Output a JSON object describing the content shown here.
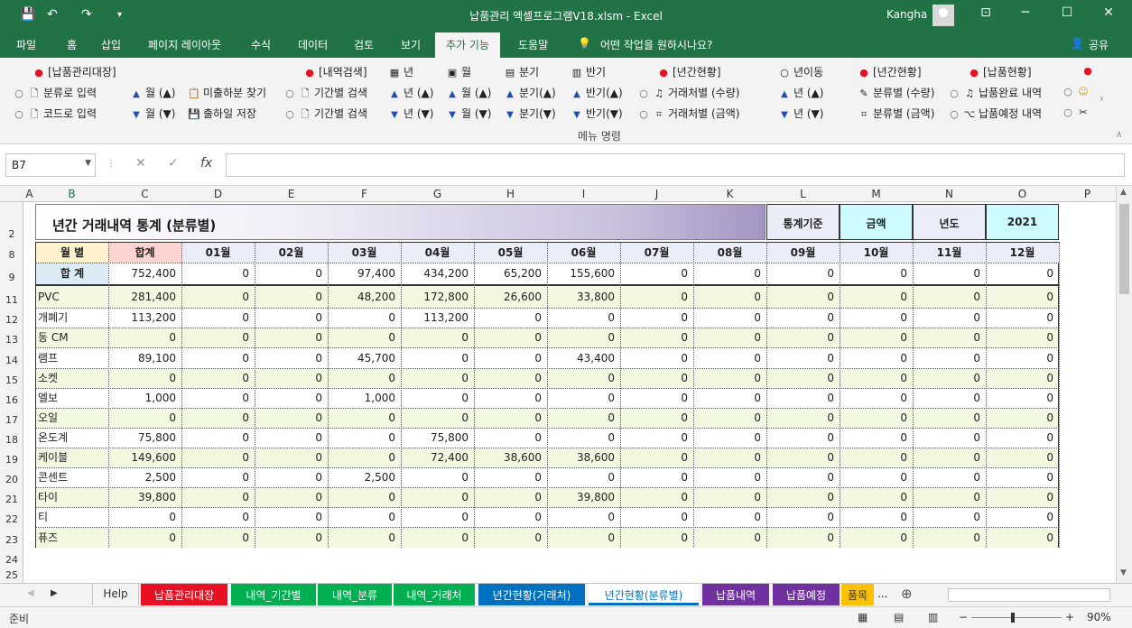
{
  "window": {
    "title": "납품관리 엑셀프로그램V18.xlsm  -  Excel",
    "user": "Kangha"
  },
  "tabs": [
    "파일",
    "홈",
    "삽입",
    "페이지 레이아웃",
    "수식",
    "데이터",
    "검토",
    "보기",
    "추가 기능",
    "도움말",
    "어떤 작업을 원하시나요?",
    "공유"
  ],
  "ribbon": {
    "r1": [
      "[납품관리대장]",
      "[내역검색]",
      "년",
      "월",
      "분기",
      "반기",
      "[년간현황]",
      "년이동",
      "[년간현황]",
      "[납품현황]"
    ],
    "r2": [
      "분류로 입력",
      "월 (▲)",
      "미출하분 찾기",
      "기간별 검색",
      "년 (▲)",
      "월 (▲)",
      "분기(▲)",
      "반기(▲)",
      "거래처별 (수량)",
      "년 (▲)",
      "분류별 (수량)",
      "납품완료 내역"
    ],
    "r3": [
      "코드로 입력",
      "월 (▼)",
      "출하일 저장",
      "기간별 검색",
      "년 (▼)",
      "월 (▼)",
      "분기(▼)",
      "반기(▼)",
      "거래처별 (금액)",
      "년 (▼)",
      "분류별 (금액)",
      "납품예정 내역"
    ],
    "footer": "메뉴 명령"
  },
  "namebox": "B7",
  "columns": [
    "A",
    "B",
    "C",
    "D",
    "E",
    "F",
    "G",
    "H",
    "I",
    "J",
    "K",
    "L",
    "M",
    "N",
    "O",
    "P"
  ],
  "rows": [
    "2",
    "8",
    "9",
    "11",
    "12",
    "13",
    "14",
    "15",
    "16",
    "17",
    "18",
    "19",
    "20",
    "21",
    "22",
    "23",
    "24",
    "25"
  ],
  "report": {
    "title": "년간 거래내역 통계 (분류별)",
    "basis_label": "통계기준",
    "basis_value": "금액",
    "year_label": "년도",
    "year_value": "2021",
    "month_header": "월  별",
    "total_header": "합계",
    "months": [
      "01월",
      "02월",
      "03월",
      "04월",
      "05월",
      "06월",
      "07월",
      "08월",
      "09월",
      "10월",
      "11월",
      "12월"
    ],
    "sum_label": "합  계",
    "sum_values": [
      "752,400",
      "0",
      "0",
      "97,400",
      "434,200",
      "65,200",
      "155,600",
      "0",
      "0",
      "0",
      "0",
      "0",
      "0"
    ],
    "items": [
      {
        "name": "PVC",
        "values": [
          "281,400",
          "0",
          "0",
          "48,200",
          "172,800",
          "26,600",
          "33,800",
          "0",
          "0",
          "0",
          "0",
          "0",
          "0"
        ]
      },
      {
        "name": "개폐기",
        "values": [
          "113,200",
          "0",
          "0",
          "0",
          "113,200",
          "0",
          "0",
          "0",
          "0",
          "0",
          "0",
          "0",
          "0"
        ]
      },
      {
        "name": "동 CM",
        "values": [
          "0",
          "0",
          "0",
          "0",
          "0",
          "0",
          "0",
          "0",
          "0",
          "0",
          "0",
          "0",
          "0"
        ]
      },
      {
        "name": "램프",
        "values": [
          "89,100",
          "0",
          "0",
          "45,700",
          "0",
          "0",
          "43,400",
          "0",
          "0",
          "0",
          "0",
          "0",
          "0"
        ]
      },
      {
        "name": "소켓",
        "values": [
          "0",
          "0",
          "0",
          "0",
          "0",
          "0",
          "0",
          "0",
          "0",
          "0",
          "0",
          "0",
          "0"
        ]
      },
      {
        "name": "엘보",
        "values": [
          "1,000",
          "0",
          "0",
          "1,000",
          "0",
          "0",
          "0",
          "0",
          "0",
          "0",
          "0",
          "0",
          "0"
        ]
      },
      {
        "name": "오일",
        "values": [
          "0",
          "0",
          "0",
          "0",
          "0",
          "0",
          "0",
          "0",
          "0",
          "0",
          "0",
          "0",
          "0"
        ]
      },
      {
        "name": "온도계",
        "values": [
          "75,800",
          "0",
          "0",
          "0",
          "75,800",
          "0",
          "0",
          "0",
          "0",
          "0",
          "0",
          "0",
          "0"
        ]
      },
      {
        "name": "케이블",
        "values": [
          "149,600",
          "0",
          "0",
          "0",
          "72,400",
          "38,600",
          "38,600",
          "0",
          "0",
          "0",
          "0",
          "0",
          "0"
        ]
      },
      {
        "name": "콘센트",
        "values": [
          "2,500",
          "0",
          "0",
          "2,500",
          "0",
          "0",
          "0",
          "0",
          "0",
          "0",
          "0",
          "0",
          "0"
        ]
      },
      {
        "name": "타이",
        "values": [
          "39,800",
          "0",
          "0",
          "0",
          "0",
          "0",
          "39,800",
          "0",
          "0",
          "0",
          "0",
          "0",
          "0"
        ]
      },
      {
        "name": "티",
        "values": [
          "0",
          "0",
          "0",
          "0",
          "0",
          "0",
          "0",
          "0",
          "0",
          "0",
          "0",
          "0",
          "0"
        ]
      },
      {
        "name": "퓨즈",
        "values": [
          "0",
          "0",
          "0",
          "0",
          "0",
          "0",
          "0",
          "0",
          "0",
          "0",
          "0",
          "0",
          "0"
        ]
      }
    ]
  },
  "sheet_tabs": [
    {
      "label": "Help",
      "color": "#f3f3f3",
      "text": "#333"
    },
    {
      "label": "납품관리대장",
      "color": "#e81123",
      "text": "#ffffff"
    },
    {
      "label": "내역_기간별",
      "color": "#00b050",
      "text": "#ffffff"
    },
    {
      "label": "내역_분류",
      "color": "#00b050",
      "text": "#ffffff"
    },
    {
      "label": "내역_거래처",
      "color": "#00b050",
      "text": "#ffffff"
    },
    {
      "label": "년간현황(거래처)",
      "color": "#0070c0",
      "text": "#ffffff"
    },
    {
      "label": "년간현황(분류별)",
      "color": "#ffffff",
      "text": "#0070c0"
    },
    {
      "label": "납품내역",
      "color": "#7030a0",
      "text": "#ffffff"
    },
    {
      "label": "납품예정",
      "color": "#7030a0",
      "text": "#ffffff"
    },
    {
      "label": "품목",
      "color": "#ffc000",
      "text": "#333333"
    }
  ],
  "status": {
    "ready": "준비",
    "zoom": "90%"
  }
}
